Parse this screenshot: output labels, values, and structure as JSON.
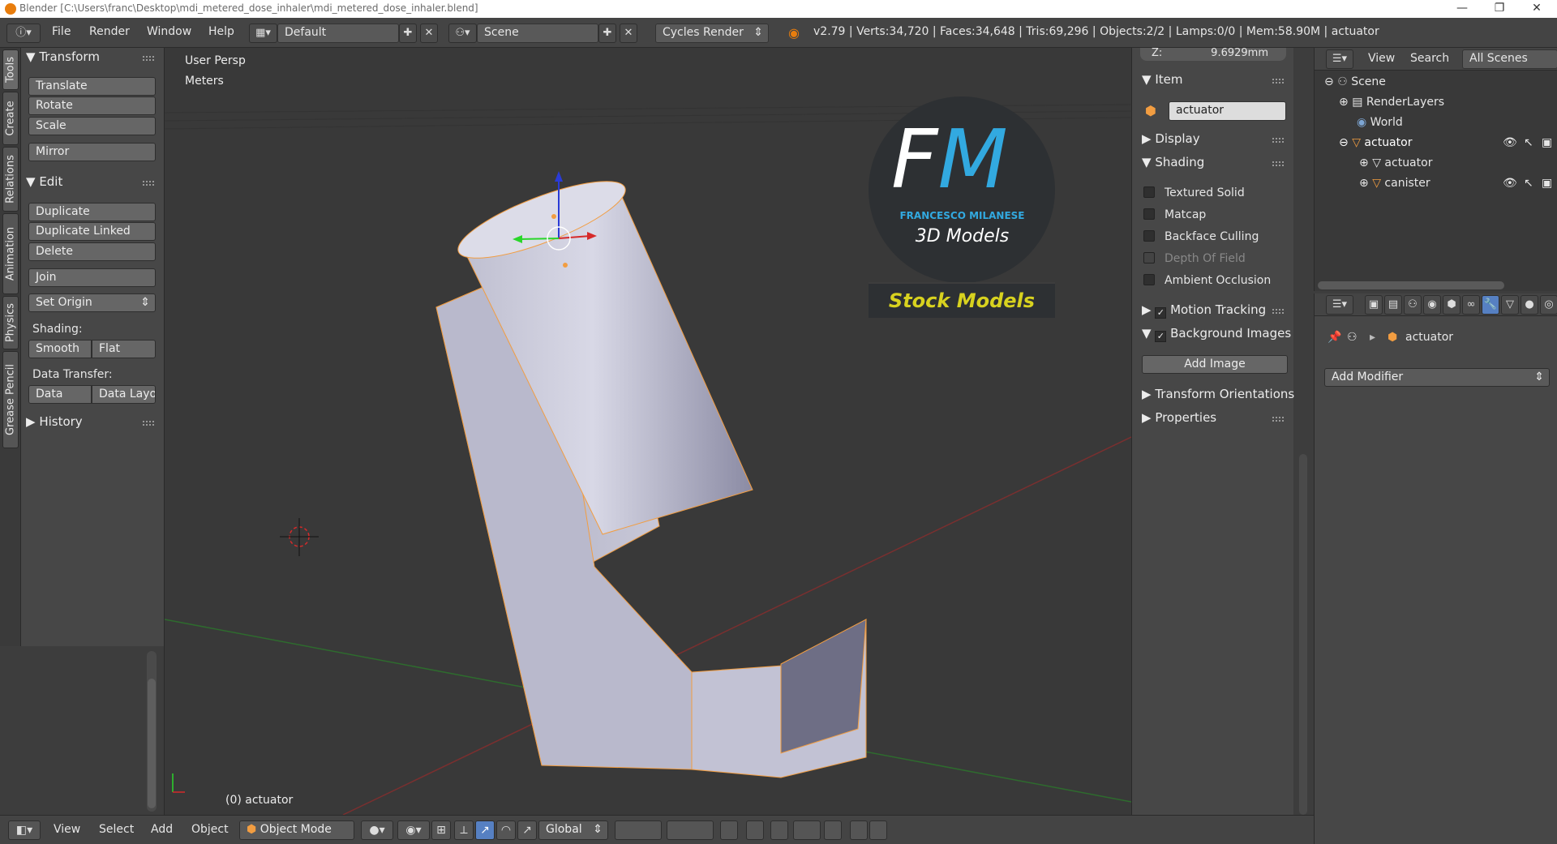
{
  "window": {
    "title": "Blender [C:\\Users\\franc\\Desktop\\mdi_metered_dose_inhaler\\mdi_metered_dose_inhaler.blend]",
    "minimize": "—",
    "maximize": "❐",
    "close": "✕"
  },
  "info_bar": {
    "menus": [
      "File",
      "Render",
      "Window",
      "Help"
    ],
    "layout": "Default",
    "scene": "Scene",
    "engine": "Cycles Render",
    "stats": "v2.79 | Verts:34,720 | Faces:34,648 | Tris:69,296 | Objects:2/2 | Lamps:0/0 | Mem:58.90M | actuator"
  },
  "left_tabs": [
    "Tools",
    "Create",
    "Relations",
    "Animation",
    "Physics",
    "Grease Pencil"
  ],
  "tool_shelf": {
    "transform_header": "Transform",
    "translate": "Translate",
    "rotate": "Rotate",
    "scale": "Scale",
    "mirror": "Mirror",
    "edit_header": "Edit",
    "duplicate": "Duplicate",
    "duplicate_linked": "Duplicate Linked",
    "delete": "Delete",
    "join": "Join",
    "set_origin": "Set Origin",
    "shading_label": "Shading:",
    "smooth": "Smooth",
    "flat": "Flat",
    "data_transfer_label": "Data Transfer:",
    "data": "Data",
    "data_layout": "Data Layo",
    "history_header": "History"
  },
  "viewport": {
    "view_name": "User Persp",
    "units": "Meters",
    "object_label": "(0) actuator",
    "logo_letters": "FM",
    "logo_name": "FRANCESCO MILANESE",
    "logo_sub": "3D Models",
    "banner": "Stock Models"
  },
  "properties_region": {
    "z_label": "Z:",
    "z_value": "9.6929mm",
    "item_header": "Item",
    "object_name": "actuator",
    "display_header": "Display",
    "shading_header": "Shading",
    "textured_solid": "Textured Solid",
    "matcap": "Matcap",
    "backface_culling": "Backface Culling",
    "depth_of_field": "Depth Of Field",
    "ambient_occlusion": "Ambient Occlusion",
    "motion_tracking": "Motion Tracking",
    "background_images": "Background Images",
    "add_image": "Add Image",
    "transform_orientations": "Transform Orientations",
    "properties_header": "Properties"
  },
  "outliner": {
    "view": "View",
    "search": "Search",
    "filter": "All Scenes",
    "items": [
      "Scene",
      "RenderLayers",
      "World",
      "actuator",
      "actuator",
      "canister"
    ]
  },
  "properties_editor": {
    "context_object": "actuator",
    "add_modifier": "Add Modifier"
  },
  "bottom_bar": {
    "menus": [
      "View",
      "Select",
      "Add",
      "Object"
    ],
    "mode": "Object Mode",
    "orientation": "Global"
  },
  "colors": {
    "accent": "#5680c2",
    "selection_orange": "#f29d41",
    "logo_blue": "#32a9e0",
    "banner_yellow": "#d8d21f"
  }
}
